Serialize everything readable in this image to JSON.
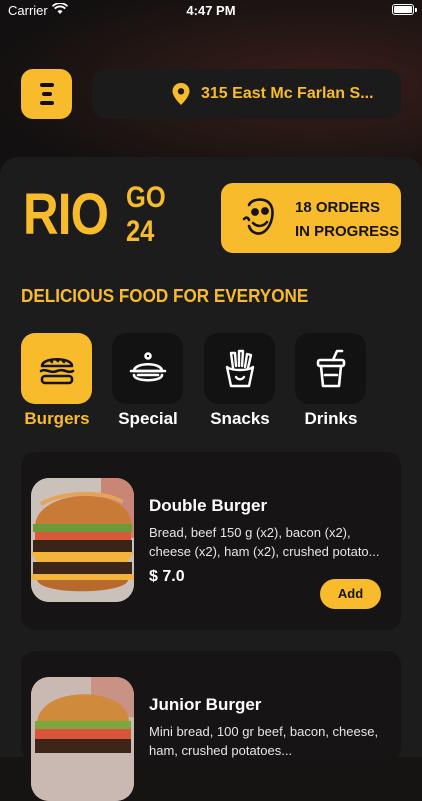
{
  "status_bar": {
    "carrier": "Carrier",
    "time": "4:47 PM"
  },
  "header": {
    "address": "315 East Mc Farlan S..."
  },
  "brand": {
    "name": "RIO",
    "suffix_top": "GO",
    "suffix_bottom": "24"
  },
  "orders": {
    "line1": "18 ORDERS",
    "line2": "IN PROGRESS"
  },
  "tagline": "DELICIOUS FOOD FOR EVERYONE",
  "categories": [
    {
      "label": "Burgers",
      "icon": "burger-icon",
      "active": true
    },
    {
      "label": "Special",
      "icon": "cloche-icon",
      "active": false
    },
    {
      "label": "Snacks",
      "icon": "fries-icon",
      "active": false
    },
    {
      "label": "Drinks",
      "icon": "cup-icon",
      "active": false
    }
  ],
  "products": [
    {
      "name": "Double Burger",
      "desc_line1": "Bread, beef 150 g (x2), bacon (x2),",
      "desc_line2": "cheese (x2), ham (x2), crushed potato...",
      "price": "$ 7.0",
      "add_label": "Add"
    },
    {
      "name": "Junior Burger",
      "desc_line1": "Mini bread, 100 gr beef, bacon, cheese,",
      "desc_line2": "ham, crushed potatoes...",
      "price": "",
      "add_label": ""
    }
  ],
  "colors": {
    "accent": "#f7bb2b",
    "card": "#161414",
    "sheet": "#1d1c1c"
  }
}
